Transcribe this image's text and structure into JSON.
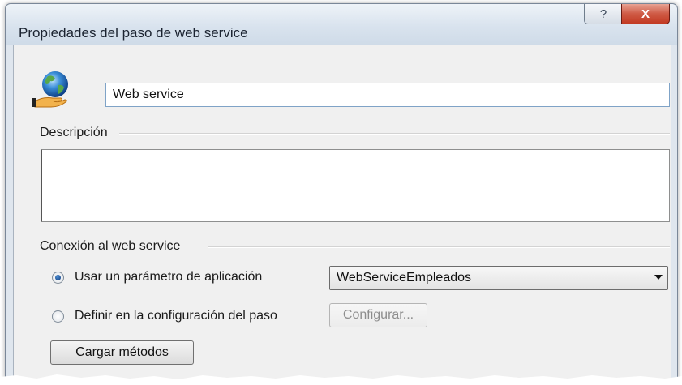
{
  "window": {
    "title": "Propiedades del paso de web service",
    "help_glyph": "?",
    "close_glyph": "X"
  },
  "step": {
    "icon": "web-service-globe-icon",
    "name_value": "Web service"
  },
  "description": {
    "label": "Descripción",
    "value": ""
  },
  "connection": {
    "label": "Conexión al web service",
    "option_app_param": {
      "label": "Usar un parámetro de aplicación",
      "checked": true
    },
    "option_step_config": {
      "label": "Definir en la configuración del paso",
      "checked": false
    },
    "parameter_selected": "WebServiceEmpleados",
    "configure_label": "Configurar...",
    "load_methods_label": "Cargar métodos"
  },
  "colors": {
    "title_bar": "#dfe6ee",
    "close_button": "#c23a23",
    "radio_dot": "#1a4f96",
    "input_border": "#7fa3c7"
  }
}
